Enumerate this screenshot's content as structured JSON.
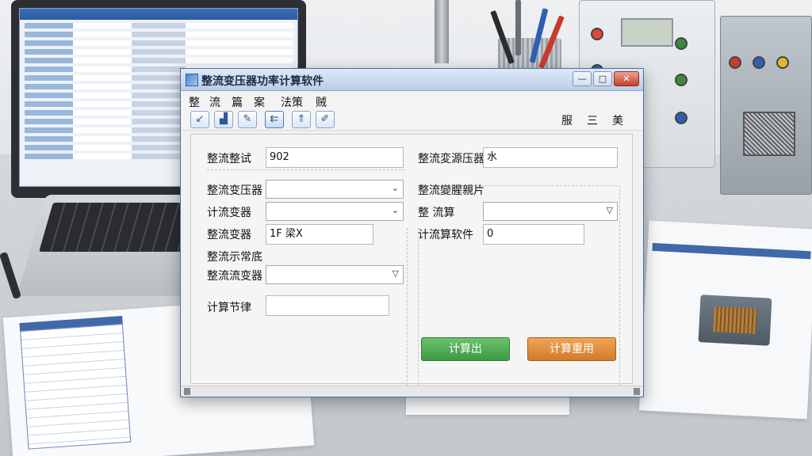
{
  "window": {
    "title": "整流变压器功率计算软件",
    "controls": {
      "minimize": "—",
      "maximize": "□",
      "close": "✕"
    }
  },
  "menu": [
    "整",
    "流",
    "篇",
    "案",
    "法策",
    "贼"
  ],
  "toolbar": {
    "tools": [
      {
        "icon": "arrow-icon",
        "glyph": "↙"
      },
      {
        "icon": "chart-icon",
        "glyph": "▟"
      },
      {
        "icon": "pin-icon",
        "glyph": "✎"
      },
      {
        "icon": "back-icon",
        "glyph": "⇇"
      },
      {
        "icon": "up-icon",
        "glyph": "⇑"
      },
      {
        "icon": "edit-icon",
        "glyph": "✐"
      }
    ],
    "right_items": [
      "服",
      "三",
      "美"
    ]
  },
  "form": {
    "left": {
      "row1": {
        "label": "整流整试",
        "value": "902"
      },
      "row2": {
        "label": "整流变压器",
        "value": ""
      },
      "row3": {
        "label": "计流变器",
        "value": ""
      },
      "row4": {
        "label": "整流变器",
        "value": "1F 梁X"
      },
      "row5": {
        "label": "整流示常底"
      },
      "row6": {
        "label": "整流流变器",
        "value": ""
      },
      "row7": {
        "label": "计算节律",
        "value": ""
      }
    },
    "right": {
      "row1": {
        "label": "整流変源压器",
        "value": "水"
      },
      "row2": {
        "label": "整流變腥親片"
      },
      "row3": {
        "label": "整 流算",
        "value": ""
      },
      "row4": {
        "label": "计流算软件",
        "value": "0"
      }
    }
  },
  "buttons": {
    "calculate": "计算出",
    "calc_apply": "计算重用"
  },
  "colors": {
    "green": "#3d9a43",
    "orange": "#d27b2a",
    "title_bg": "#b9cde8"
  }
}
